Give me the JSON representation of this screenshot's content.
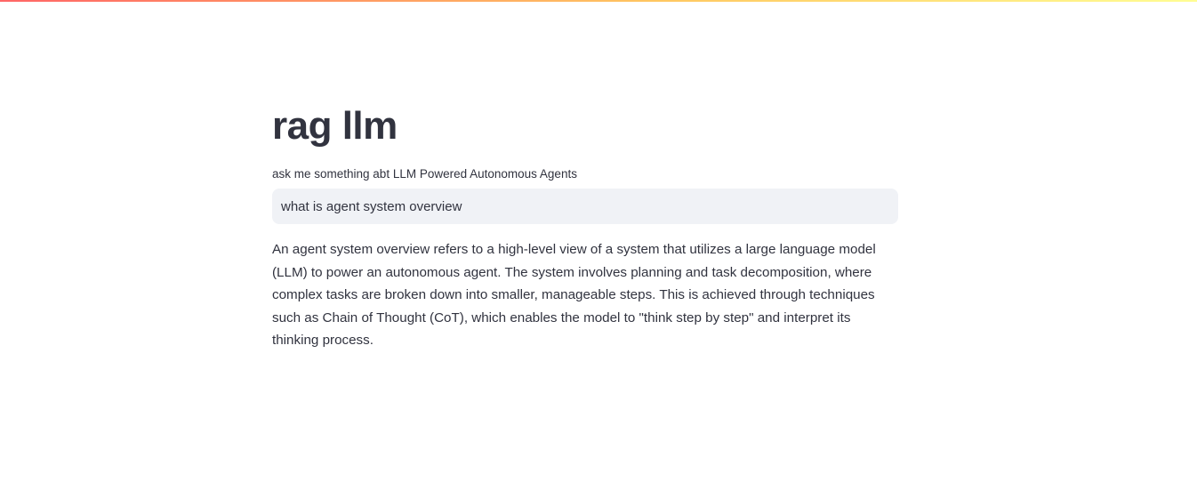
{
  "app": {
    "title": "rag llm"
  },
  "query": {
    "label": "ask me something abt LLM Powered Autonomous Agents",
    "value": "what is agent system overview"
  },
  "answer": {
    "text": "An agent system overview refers to a high-level view of a system that utilizes a large language model (LLM) to power an autonomous agent. The system involves planning and task decomposition, where complex tasks are broken down into smaller, manageable steps. This is achieved through techniques such as Chain of Thought (CoT), which enables the model to \"think step by step\" and interpret its thinking process."
  },
  "colors": {
    "text": "#31333f",
    "input_background": "#f0f2f6",
    "header_gradient_start": "#ff4b4b",
    "header_gradient_end": "#fffd80"
  }
}
